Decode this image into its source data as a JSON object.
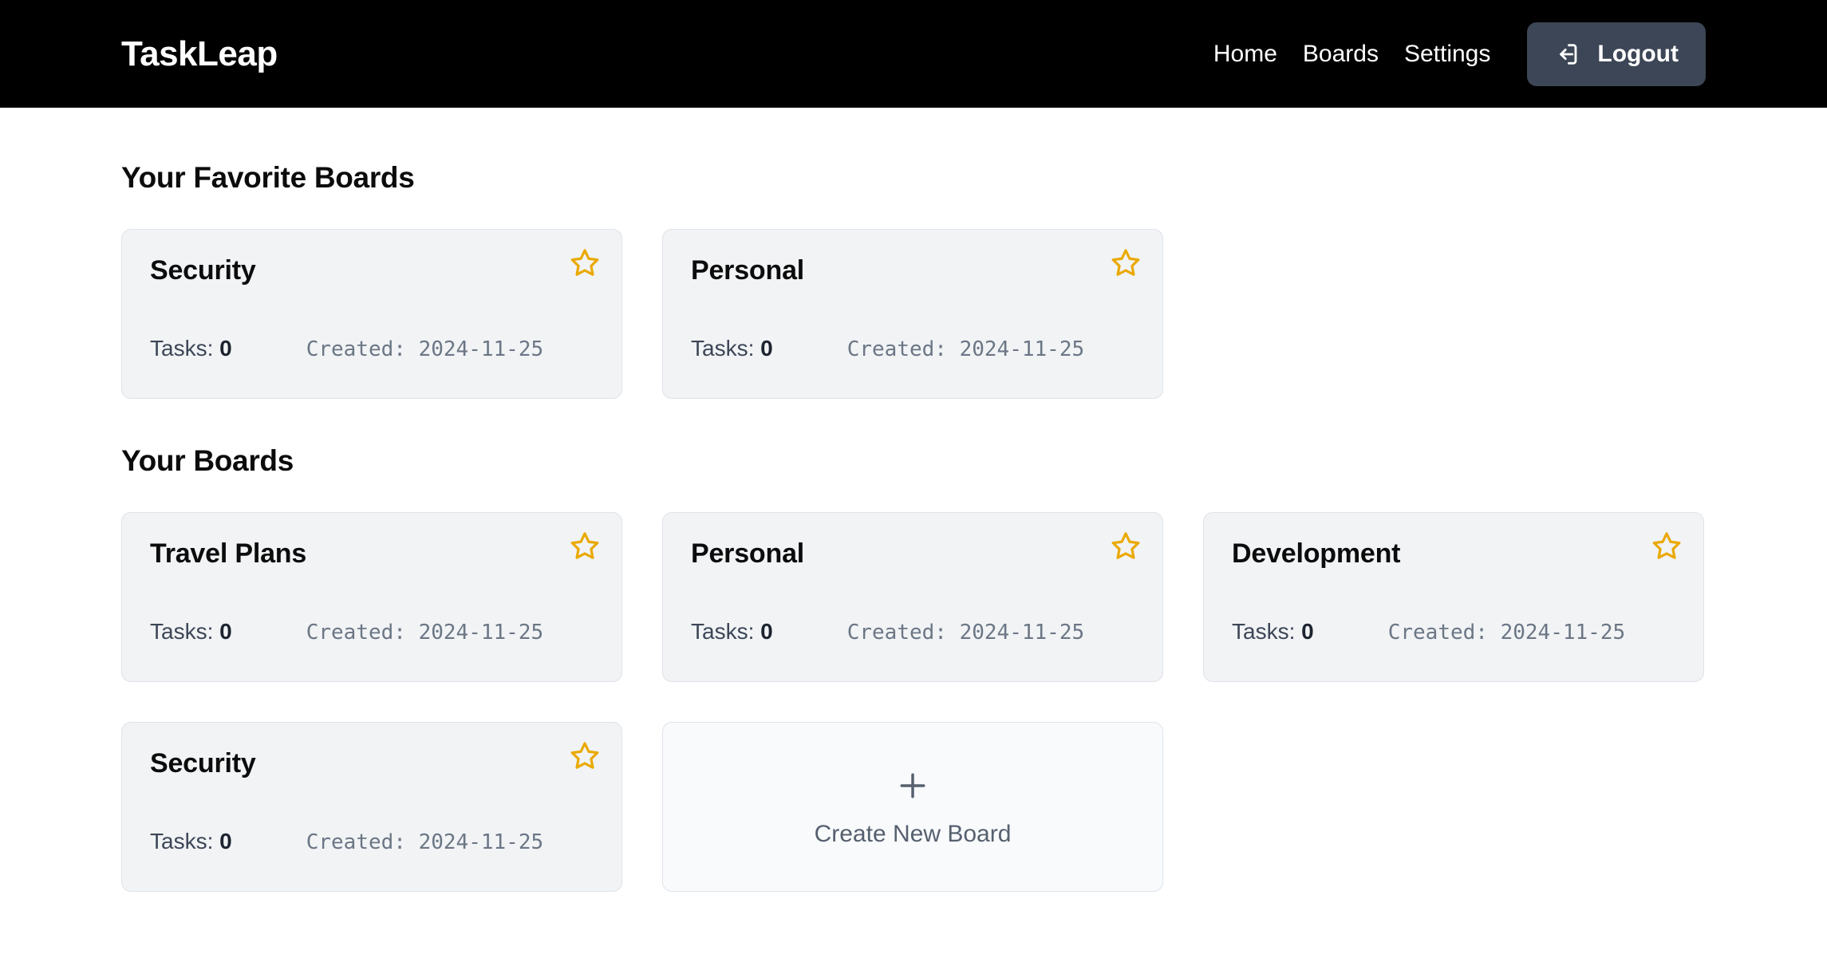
{
  "app": {
    "brand": "TaskLeap",
    "accent_star": "#eaa900",
    "header_bg": "#000000",
    "logout_bg": "#3c4656",
    "card_bg": "#f1f3f5",
    "card_border": "#dfe3e8"
  },
  "nav": {
    "links": [
      {
        "label": "Home"
      },
      {
        "label": "Boards"
      },
      {
        "label": "Settings"
      }
    ],
    "logout": {
      "label": "Logout",
      "icon": "logout-icon"
    }
  },
  "sections": {
    "favorites": {
      "title": "Your Favorite Boards",
      "cards": [
        {
          "title": "Security",
          "tasks_label": "Tasks:",
          "tasks_count": "0",
          "created": "Created: 2024-11-25",
          "favorited": true,
          "star_icon": "star-icon"
        },
        {
          "title": "Personal",
          "tasks_label": "Tasks:",
          "tasks_count": "0",
          "created": "Created: 2024-11-25",
          "favorited": true,
          "star_icon": "star-icon"
        }
      ]
    },
    "boards": {
      "title": "Your Boards",
      "cards": [
        {
          "title": "Travel Plans",
          "tasks_label": "Tasks:",
          "tasks_count": "0",
          "created": "Created: 2024-11-25",
          "favorited": true,
          "star_icon": "star-icon"
        },
        {
          "title": "Personal",
          "tasks_label": "Tasks:",
          "tasks_count": "0",
          "created": "Created: 2024-11-25",
          "favorited": true,
          "star_icon": "star-icon"
        },
        {
          "title": "Development",
          "tasks_label": "Tasks:",
          "tasks_count": "0",
          "created": "Created: 2024-11-25",
          "favorited": true,
          "star_icon": "star-icon"
        },
        {
          "title": "Security",
          "tasks_label": "Tasks:",
          "tasks_count": "0",
          "created": "Created: 2024-11-25",
          "favorited": true,
          "star_icon": "star-icon"
        }
      ],
      "create_card": {
        "label": "Create New Board",
        "icon": "plus-icon"
      }
    }
  }
}
